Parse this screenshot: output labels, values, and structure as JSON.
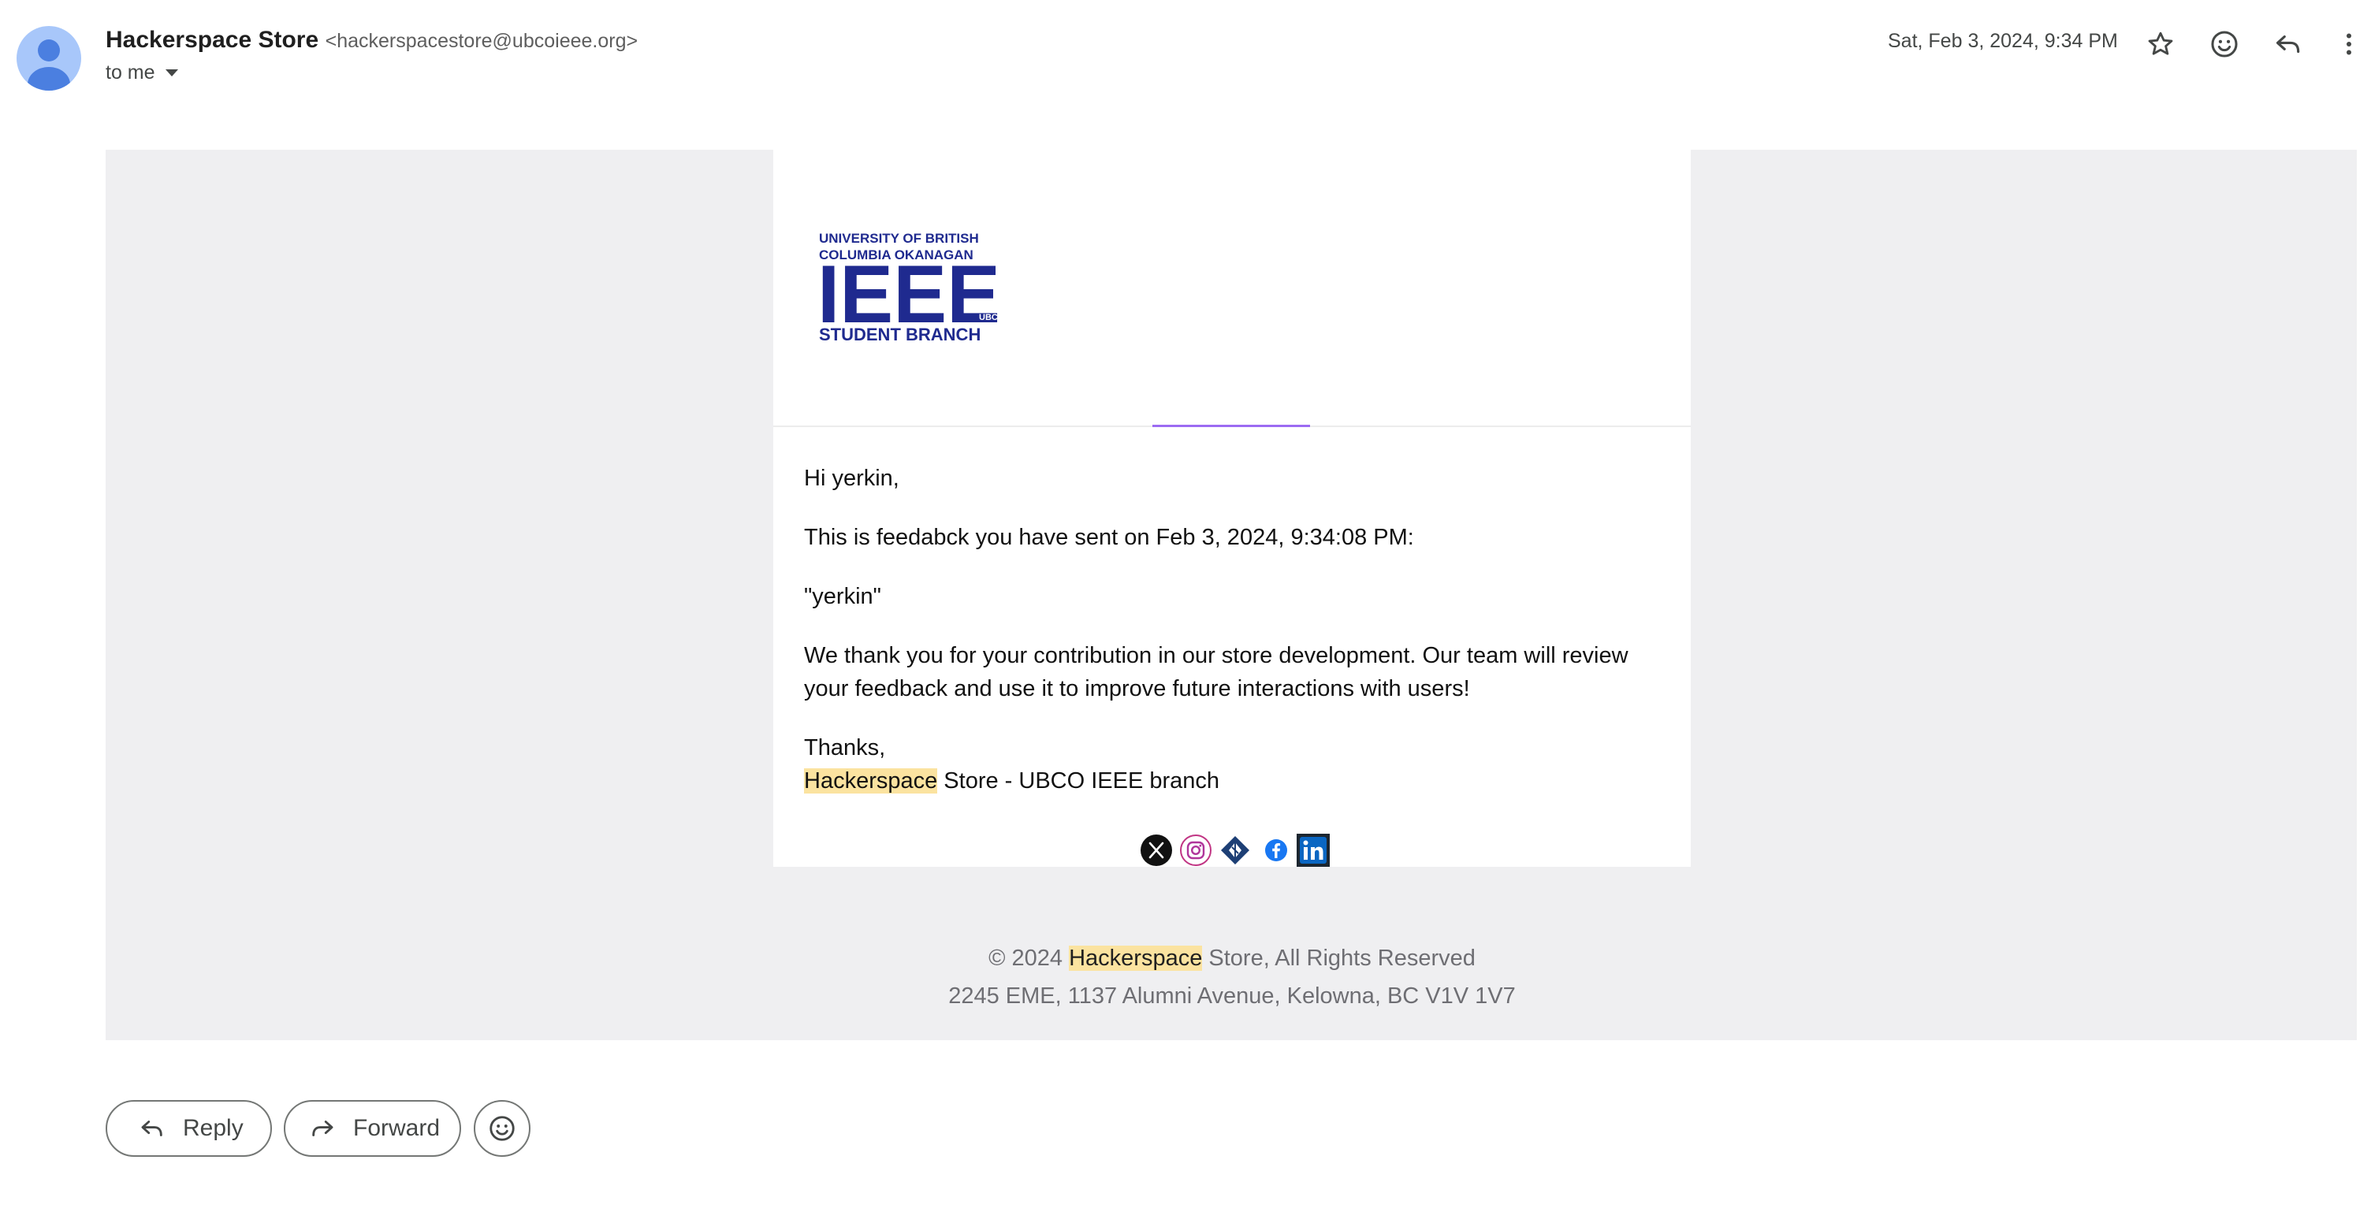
{
  "header": {
    "sender_name": "Hackerspace Store",
    "sender_email": "<hackerspacestore@ubcoieee.org>",
    "recipient": "to me",
    "date": "Sat, Feb 3, 2024, 9:34 PM",
    "icons": [
      "star-icon",
      "emoji-icon",
      "reply-icon",
      "more-vert-icon"
    ]
  },
  "logo": {
    "line1": "UNIVERSITY OF BRITISH",
    "line2": "COLUMBIA OKANAGAN",
    "main": "IEEE",
    "small": "UBCO",
    "line3": "STUDENT BRANCH",
    "color": "#1f2a8f"
  },
  "message": {
    "greeting": "Hi yerkin,",
    "intro": "This is feedabck you have sent on Feb 3, 2024, 9:34:08 PM:",
    "quote": "\"yerkin\"",
    "body": "We thank you for your contribution in our store development. Our team will review your feedback and use it to improve future interactions with users!",
    "signoff": "Thanks,",
    "signature_highlight": "Hackerspace",
    "signature_rest": " Store - UBCO IEEE branch"
  },
  "social_icons": [
    "x-icon",
    "instagram-icon",
    "ieee-icon",
    "facebook-icon",
    "linkedin-icon"
  ],
  "footer": {
    "copyright_prefix": "© 2024 ",
    "copyright_highlight": "Hackerspace",
    "copyright_suffix": " Store, All Rights Reserved",
    "address": "2245 EME, 1137 Alumni Avenue, Kelowna, BC V1V 1V7"
  },
  "actions": {
    "reply_label": "Reply",
    "forward_label": "Forward"
  },
  "colors": {
    "accent_line": "#9c6bf2",
    "highlight": "#fbe3a0",
    "avatar": "#a8c7fa",
    "body_bg": "#efeff1"
  }
}
